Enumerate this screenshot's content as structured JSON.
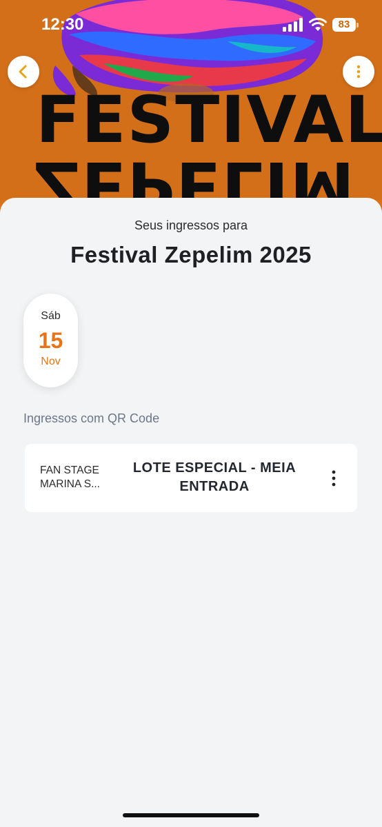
{
  "status_bar": {
    "time": "12:30",
    "battery_level": "83",
    "icons": [
      "signal-icon",
      "wifi-icon",
      "battery-icon"
    ]
  },
  "banner": {
    "line1": "FESTIVAL",
    "line2": "ZEPELIM",
    "colors": {
      "background": "#d9731b",
      "text": "#0e0e0e"
    }
  },
  "nav": {
    "back_icon": "chevron-left-icon",
    "more_icon": "more-vertical-icon",
    "accent": "#e8a21a"
  },
  "header": {
    "subtitle": "Seus ingressos para",
    "title": "Festival Zepelim 2025"
  },
  "date": {
    "weekday": "Sáb",
    "day": "15",
    "month": "Nov",
    "accent": "#e8741a"
  },
  "tickets_section": {
    "label": "Ingressos com QR Code",
    "items": [
      {
        "sector_line1": "FAN STAGE",
        "sector_line2": "MARINA S...",
        "type": "LOTE ESPECIAL - MEIA ENTRADA",
        "menu_icon": "more-vertical-icon"
      }
    ]
  }
}
